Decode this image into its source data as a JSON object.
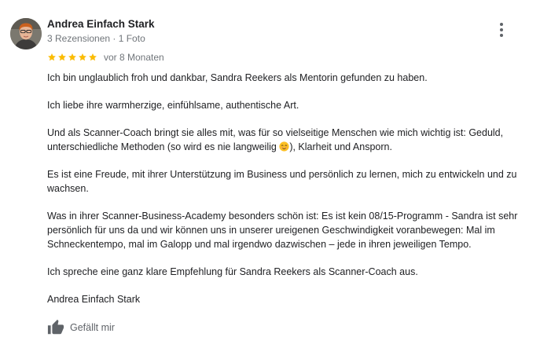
{
  "author": {
    "name": "Andrea Einfach Stark",
    "meta": "3 Rezensionen · 1 Foto",
    "avatar_icon": "user-avatar-photo"
  },
  "rating": {
    "stars": 5,
    "max_stars": 5,
    "star_color": "#fbbc04",
    "date": "vor 8 Monaten"
  },
  "menu": {
    "icon": "more-vertical-icon"
  },
  "review": {
    "p1": "Ich bin unglaublich froh und dankbar, Sandra Reekers als Mentorin gefunden zu haben.",
    "p2": "Ich liebe ihre warmherzige, einfühlsame, authentische Art.",
    "p3_before_emoji": "Und als Scanner-Coach bringt sie alles mit, was für so vielseitige Menschen wie mich wichtig ist: Geduld, unterschiedliche Methoden (so wird es nie langweilig ",
    "p3_emoji": "smiling-face-emoji",
    "p3_after_emoji": "), Klarheit und Ansporn.",
    "p4": "Es ist eine Freude, mit ihrer Unterstützung im Business und persönlich zu lernen, mich zu entwickeln und zu wachsen.",
    "p5": "Was in ihrer Scanner-Business-Academy besonders schön ist: Es ist kein 08/15-Programm - Sandra ist sehr persönlich für uns da und wir können uns in unserer ureigenen Geschwindigkeit voranbewegen: Mal im Schneckentempo, mal im Galopp und mal irgendwo dazwischen – jede in ihren jeweiligen Tempo.",
    "p6": "Ich spreche eine ganz klare Empfehlung für Sandra Reekers als Scanner-Coach aus.",
    "signature": "Andrea Einfach Stark"
  },
  "actions": {
    "like_label": "Gefällt mir",
    "like_icon": "thumbs-up-icon"
  }
}
